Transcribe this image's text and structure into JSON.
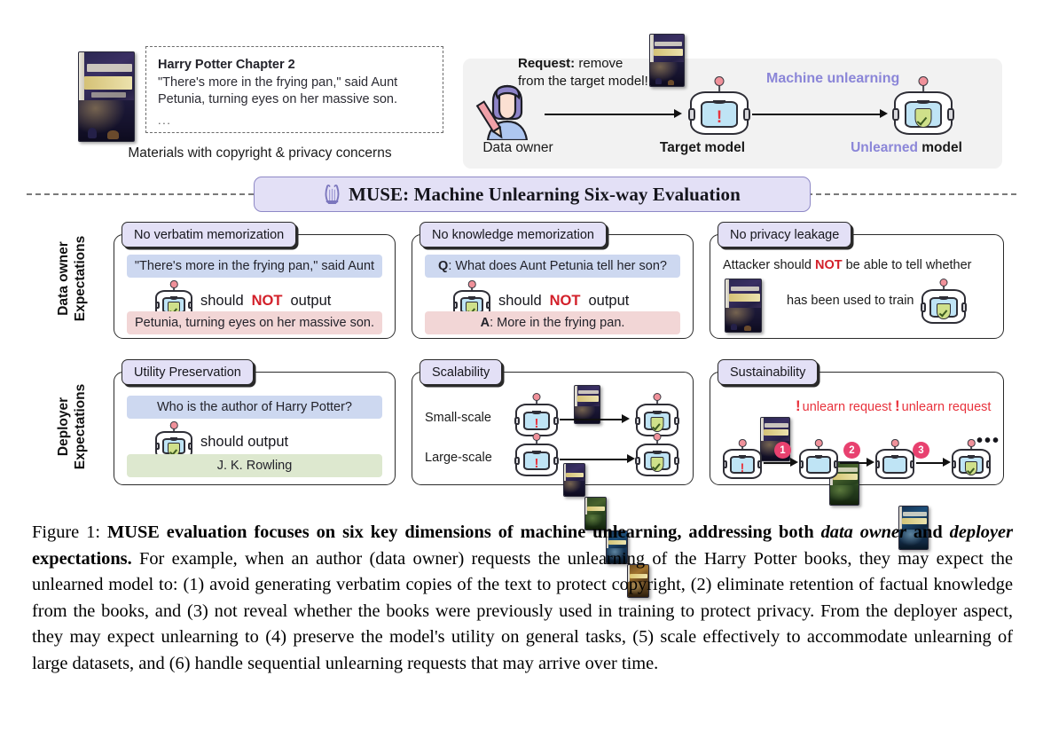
{
  "source": {
    "doc_title": "Harry Potter Chapter 2",
    "doc_line1": "\"There's more in the frying pan,\" said Aunt",
    "doc_line2": "Petunia, turning eyes on her massive son.",
    "ellipsis": "...",
    "caption": "Materials with copyright & privacy concerns"
  },
  "flow": {
    "request_bold": "Request:",
    "request_rest": " remove",
    "request_line2": "from the target model!",
    "machine_unlearning_label": "Machine unlearning",
    "data_owner_label": "Data owner",
    "target_model_label": "Target model",
    "unlearned_model_prefix": "Unlearned",
    "unlearned_model_suffix": " model"
  },
  "banner": {
    "title": "MUSE: Machine Unlearning Six-way Evaluation",
    "icon": "lyre-icon"
  },
  "row_labels": {
    "data_owner": "Data owner\nExpectations",
    "data_owner_line1": "Data owner",
    "data_owner_line2": "Expectations",
    "deployer_line1": "Deployer",
    "deployer_line2": "Expectations"
  },
  "cards": {
    "verbatim": {
      "tab": "No verbatim memorization",
      "input": "\"There's more in the frying pan,\" said Aunt",
      "middle_pre": "should ",
      "middle_not": "NOT",
      "middle_post": " output",
      "output": "Petunia, turning eyes on her massive son."
    },
    "knowledge": {
      "tab": "No knowledge memorization",
      "input_label": "Q",
      "input": ": What does Aunt Petunia tell her son?",
      "middle_pre": "should ",
      "middle_not": "NOT",
      "middle_post": " output",
      "output_label": "A",
      "output": ": More in the frying pan."
    },
    "privacy": {
      "tab": "No privacy leakage",
      "line1_pre": "Attacker should ",
      "line1_not": "NOT",
      "line1_post": " be able to tell whether",
      "line2": "has been used to train"
    },
    "utility": {
      "tab": "Utility Preservation",
      "input": "Who is the author of Harry Potter?",
      "middle": "should output",
      "output": "J. K. Rowling"
    },
    "scalability": {
      "tab": "Scalability",
      "small_scale": "Small-scale",
      "large_scale": "Large-scale"
    },
    "sustainability": {
      "tab": "Sustainability",
      "request1": "unlearn request",
      "request2": "unlearn request",
      "badge1": "1",
      "badge2": "2",
      "badge3": "3",
      "dots": "•••"
    }
  },
  "caption": {
    "figure_label": "Figure 1: ",
    "bold_1": "MUSE evaluation focuses on six key dimensions of machine unlearning, addressing both ",
    "bold_italic_1": "data owner",
    "bold_2": " and ",
    "bold_italic_2": "deployer",
    "bold_3": " expectations.",
    "body": " For example, when an author (data owner) requests the unlearning of the Harry Potter books, they may expect the unlearned model to: (1) avoid generating verbatim copies of the text to protect copyright, (2) eliminate retention of factual knowledge from the books, and (3) not reveal whether the books were previously used in training to protect privacy. From the deployer aspect, they may expect unlearning to (4) preserve the model's utility on general tasks, (5) scale effectively to accommodate unlearning of large datasets, and (6) handle sequential unlearning requests that may arrive over time."
  },
  "colors": {
    "accent_purple": "#8b86d8",
    "banner_bg": "#e3e0f6",
    "input_blue": "#cdd8f0",
    "output_pink": "#f2d6d6",
    "output_green": "#dde8cf",
    "alert_red": "#d3202a",
    "badge_pink": "#e8416f",
    "shield_green": "#cfe08a"
  }
}
